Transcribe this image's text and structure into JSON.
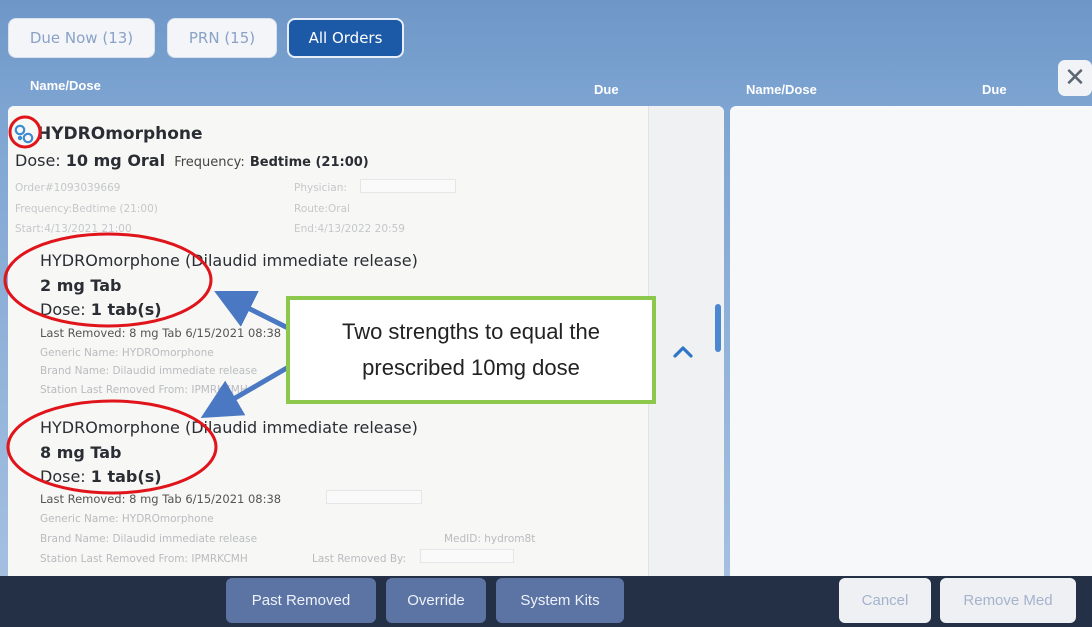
{
  "tabs": [
    {
      "label": "Due Now (13)",
      "active": false
    },
    {
      "label": "PRN (15)",
      "active": false
    },
    {
      "label": "All Orders",
      "active": true
    }
  ],
  "headers": {
    "left_name": "Name/Dose",
    "left_due": "Due",
    "right_name": "Name/Dose",
    "right_due": "Due",
    "close_glyph": "✕"
  },
  "order": {
    "icon": "linked-order-icon",
    "name": "HYDROmorphone",
    "dose_prefix": "Dose:",
    "dose_value": "10 mg Oral",
    "frequency_prefix": "Frequency:",
    "frequency_value": "Bedtime (21:00)",
    "order_no": "Order#1093039669",
    "physician_label": "Physician:",
    "frequency_line": "Frequency:Bedtime (21:00)",
    "route": "Route:Oral",
    "start": "Start:4/13/2021 21:00",
    "end": "End:4/13/2022 20:59"
  },
  "items": [
    {
      "title": "HYDROmorphone (Dilaudid immediate release)",
      "strength": "2 mg Tab",
      "dose_prefix": "Dose:",
      "dose_value": "1 tab(s)",
      "last_removed": "Last Removed: 8 mg Tab 6/15/2021 08:38",
      "generic": "Generic Name: HYDROmorphone",
      "brand": "Brand Name: Dilaudid immediate release",
      "station": "Station Last Removed From: IPMRKCMH"
    },
    {
      "title": "HYDROmorphone (Dilaudid immediate release)",
      "strength": "8 mg Tab",
      "dose_prefix": "Dose:",
      "dose_value": "1 tab(s)",
      "last_removed": "Last Removed: 8 mg Tab 6/15/2021 08:38",
      "generic": "Generic Name: HYDROmorphone",
      "brand": "Brand Name: Dilaudid immediate release",
      "medid": "MedID: hydrom8t",
      "station": "Station Last Removed From: IPMRKCMH",
      "last_removed_by": "Last Removed By:"
    }
  ],
  "scroll_up_icon": "chevron-up-icon",
  "annotation": {
    "line1": "Two strengths to equal the",
    "line2": "prescribed 10mg dose",
    "border_color": "#8cc84b",
    "circle_color": "#e0151b",
    "arrow_color": "#4a78c2"
  },
  "bottom": {
    "past_removed": "Past Removed",
    "override": "Override",
    "system_kits": "System Kits",
    "cancel": "Cancel",
    "remove_med": "Remove Med"
  }
}
